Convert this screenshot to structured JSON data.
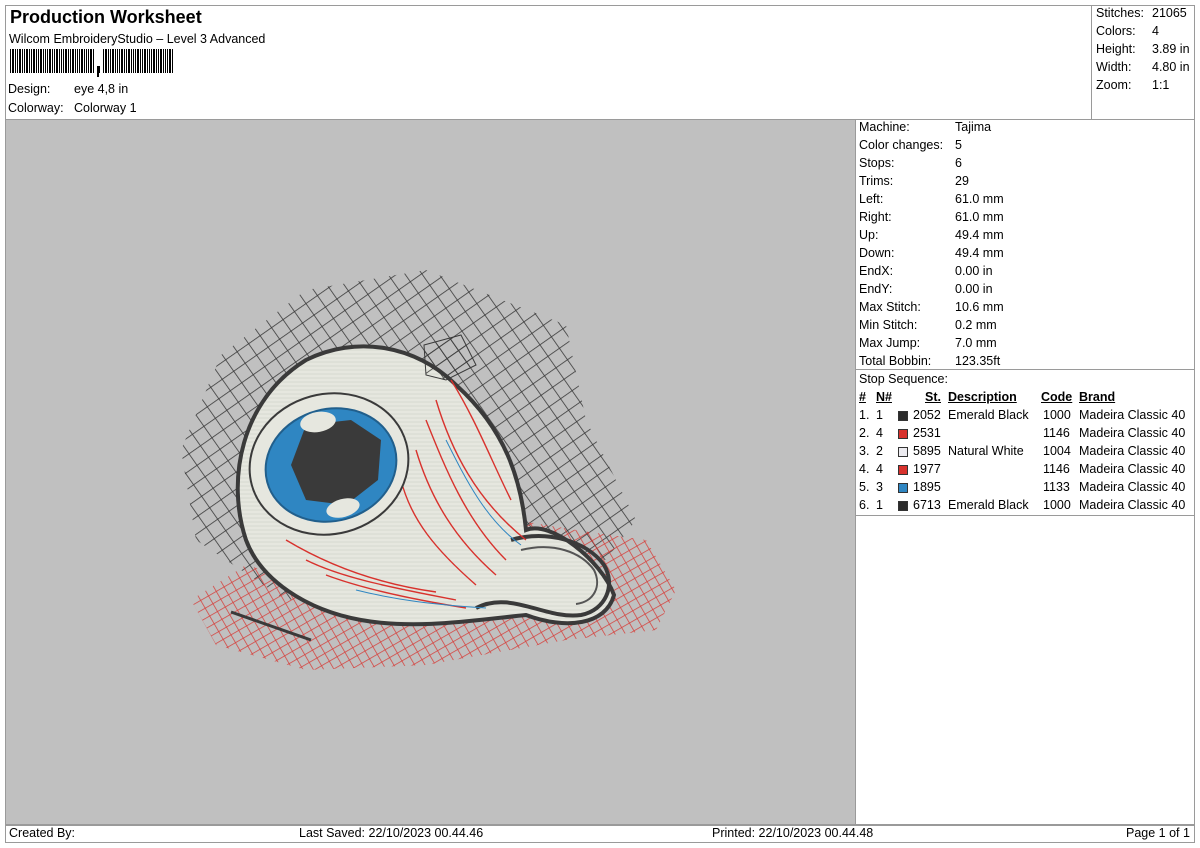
{
  "header": {
    "title": "Production Worksheet",
    "subtitle": "Wilcom EmbroideryStudio – Level 3 Advanced",
    "design_label": "Design:",
    "design_value": "eye 4,8 in",
    "colorway_label": "Colorway:",
    "colorway_value": "Colorway 1"
  },
  "stats": {
    "stitches_label": "Stitches:",
    "stitches": "21065",
    "colors_label": "Colors:",
    "colors": "4",
    "height_label": "Height:",
    "height": "3.89 in",
    "width_label": "Width:",
    "width": "4.80 in",
    "zoom_label": "Zoom:",
    "zoom": "1:1"
  },
  "machine": {
    "rows": [
      {
        "label": "Machine:",
        "value": "Tajima"
      },
      {
        "label": "Color changes:",
        "value": "5"
      },
      {
        "label": "Stops:",
        "value": "6"
      },
      {
        "label": "Trims:",
        "value": "29"
      },
      {
        "label": "Left:",
        "value": "61.0 mm"
      },
      {
        "label": "Right:",
        "value": "61.0 mm"
      },
      {
        "label": "Up:",
        "value": "49.4 mm"
      },
      {
        "label": "Down:",
        "value": "49.4 mm"
      },
      {
        "label": "EndX:",
        "value": "0.00 in"
      },
      {
        "label": "EndY:",
        "value": "0.00 in"
      },
      {
        "label": "Max Stitch:",
        "value": "10.6 mm"
      },
      {
        "label": "Min Stitch:",
        "value": "0.2 mm"
      },
      {
        "label": "Max Jump:",
        "value": "7.0 mm"
      },
      {
        "label": "Total Bobbin:",
        "value": "123.35ft"
      }
    ]
  },
  "stop_sequence": {
    "title": "Stop Sequence:",
    "headers": {
      "idx": "#",
      "n": "N#",
      "st": "St.",
      "description": "Description",
      "code": "Code",
      "brand": "Brand"
    },
    "rows": [
      {
        "idx": "1.",
        "n": "1",
        "color": "#2b2b2b",
        "st": "2052",
        "description": "Emerald Black",
        "code": "1000",
        "brand": "Madeira Classic 40"
      },
      {
        "idx": "2.",
        "n": "4",
        "color": "#d8322d",
        "st": "2531",
        "description": "",
        "code": "1146",
        "brand": "Madeira Classic 40"
      },
      {
        "idx": "3.",
        "n": "2",
        "color": "#ecebf0",
        "st": "5895",
        "description": "Natural White",
        "code": "1004",
        "brand": "Madeira Classic 40"
      },
      {
        "idx": "4.",
        "n": "4",
        "color": "#d8322d",
        "st": "1977",
        "description": "",
        "code": "1146",
        "brand": "Madeira Classic 40"
      },
      {
        "idx": "5.",
        "n": "3",
        "color": "#2f86c2",
        "st": "1895",
        "description": "",
        "code": "1133",
        "brand": "Madeira Classic 40"
      },
      {
        "idx": "6.",
        "n": "1",
        "color": "#2b2b2b",
        "st": "6713",
        "description": "Emerald Black",
        "code": "1000",
        "brand": "Madeira Classic 40"
      }
    ]
  },
  "footer": {
    "created_by": "Created By:",
    "last_saved": "Last Saved: 22/10/2023 00.44.46",
    "printed": "Printed: 22/10/2023 00.44.48",
    "page": "Page 1 of 1"
  },
  "colors": {
    "preview_bg": "#c0c0c0",
    "thread_black": "#3a3a3a",
    "thread_red": "#d8322d",
    "thread_white": "#e8e9e2",
    "thread_blue": "#2f86c2"
  }
}
